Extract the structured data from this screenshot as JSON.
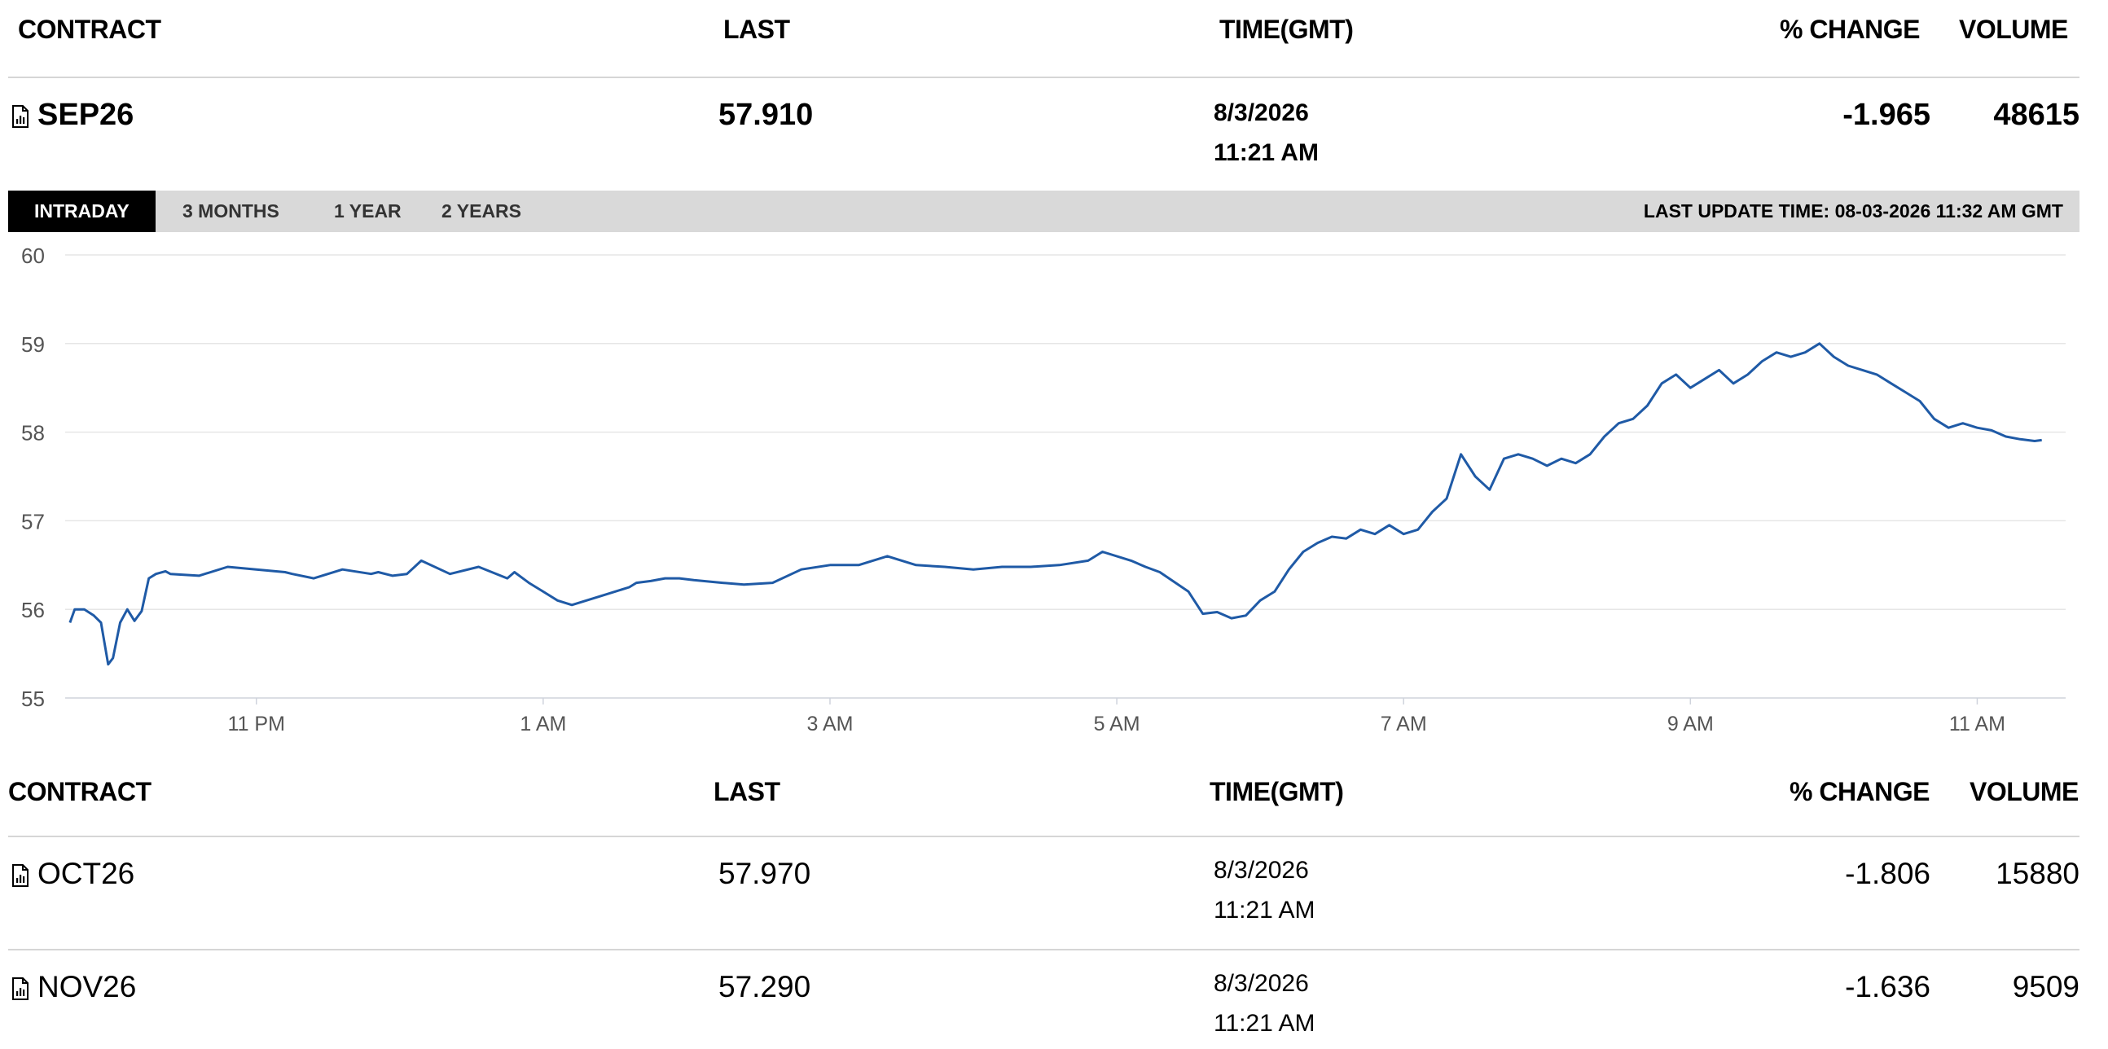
{
  "top_table": {
    "headers": {
      "contract": "CONTRACT",
      "last": "LAST",
      "time": "TIME(GMT)",
      "pct_change": "% CHANGE",
      "volume": "VOLUME"
    },
    "row": {
      "contract": "SEP26",
      "last": "57.910",
      "date": "8/3/2026",
      "time": "11:21 AM",
      "pct_change": "-1.965",
      "volume": "48615"
    }
  },
  "tabs": {
    "items": [
      "INTRADAY",
      "3 MONTHS",
      "1 YEAR",
      "2 YEARS"
    ],
    "active": "INTRADAY",
    "last_update": "LAST UPDATE TIME: 08-03-2026 11:32 AM GMT"
  },
  "chart_data": {
    "type": "line",
    "title": "",
    "xlabel": "",
    "ylabel": "",
    "ylim": [
      55,
      60
    ],
    "yticks": [
      "60",
      "59",
      "58",
      "57",
      "56",
      "55"
    ],
    "xticks": [
      "11 PM",
      "1 AM",
      "3 AM",
      "5 AM",
      "7 AM",
      "9 AM",
      "11 AM"
    ],
    "grid": true,
    "line_color": "#1f5aa6",
    "series": [
      {
        "name": "",
        "x": [
          "21:42",
          "21:44",
          "21:48",
          "21:52",
          "21:55",
          "21:58",
          "22:00",
          "22:03",
          "22:06",
          "22:09",
          "22:12",
          "22:15",
          "22:18",
          "22:22",
          "22:24",
          "22:36",
          "22:48",
          "23:00",
          "23:12",
          "23:15",
          "23:24",
          "23:36",
          "23:48",
          "23:51",
          "23:57",
          "00:03",
          "00:09",
          "00:21",
          "00:33",
          "00:45",
          "00:48",
          "00:54",
          "01:00",
          "01:06",
          "01:12",
          "01:24",
          "01:36",
          "01:39",
          "01:45",
          "01:51",
          "01:57",
          "02:03",
          "02:15",
          "02:24",
          "02:36",
          "02:48",
          "03:00",
          "03:12",
          "03:24",
          "03:36",
          "03:48",
          "04:00",
          "04:12",
          "04:24",
          "04:36",
          "04:48",
          "04:54",
          "05:06",
          "05:12",
          "05:18",
          "05:30",
          "05:36",
          "05:42",
          "05:48",
          "05:54",
          "06:00",
          "06:06",
          "06:12",
          "06:18",
          "06:24",
          "06:30",
          "06:36",
          "06:42",
          "06:48",
          "06:54",
          "07:00",
          "07:06",
          "07:12",
          "07:18",
          "07:24",
          "07:30",
          "07:36",
          "07:42",
          "07:48",
          "07:54",
          "08:00",
          "08:06",
          "08:12",
          "08:18",
          "08:24",
          "08:30",
          "08:36",
          "08:42",
          "08:48",
          "08:54",
          "09:00",
          "09:06",
          "09:12",
          "09:18",
          "09:24",
          "09:30",
          "09:36",
          "09:42",
          "09:48",
          "09:54",
          "10:00",
          "10:06",
          "10:12",
          "10:18",
          "10:24",
          "10:30",
          "10:36",
          "10:42",
          "10:48",
          "10:54",
          "11:00",
          "11:06",
          "11:12",
          "11:18",
          "11:24",
          "11:27"
        ],
        "values": [
          55.85,
          56.0,
          56.0,
          55.93,
          55.85,
          55.38,
          55.45,
          55.85,
          56.0,
          55.87,
          55.98,
          56.35,
          56.4,
          56.43,
          56.4,
          56.38,
          56.48,
          56.45,
          56.42,
          56.4,
          56.35,
          56.45,
          56.4,
          56.42,
          56.38,
          56.4,
          56.55,
          56.4,
          56.48,
          56.35,
          56.42,
          56.3,
          56.2,
          56.1,
          56.05,
          56.15,
          56.25,
          56.3,
          56.32,
          56.35,
          56.35,
          56.33,
          56.3,
          56.28,
          56.3,
          56.45,
          56.5,
          56.5,
          56.6,
          56.5,
          56.48,
          56.45,
          56.48,
          56.48,
          56.5,
          56.55,
          56.65,
          56.55,
          56.48,
          56.42,
          56.2,
          55.95,
          55.97,
          55.9,
          55.93,
          56.1,
          56.2,
          56.45,
          56.65,
          56.75,
          56.82,
          56.8,
          56.9,
          56.85,
          56.95,
          56.85,
          56.9,
          57.1,
          57.25,
          57.75,
          57.5,
          57.35,
          57.7,
          57.75,
          57.7,
          57.62,
          57.7,
          57.65,
          57.75,
          57.95,
          58.1,
          58.15,
          58.3,
          58.55,
          58.65,
          58.5,
          58.6,
          58.7,
          58.55,
          58.65,
          58.8,
          58.9,
          58.85,
          58.9,
          59.0,
          58.85,
          58.75,
          58.7,
          58.65,
          58.55,
          58.45,
          58.35,
          58.15,
          58.05,
          58.1,
          58.05,
          58.02,
          57.95,
          57.92,
          57.9,
          57.91
        ]
      }
    ]
  },
  "bottom_table": {
    "headers": {
      "contract": "CONTRACT",
      "last": "LAST",
      "time": "TIME(GMT)",
      "pct_change": "% CHANGE",
      "volume": "VOLUME"
    },
    "rows": [
      {
        "contract": "OCT26",
        "last": "57.970",
        "date": "8/3/2026",
        "time": "11:21 AM",
        "pct_change": "-1.806",
        "volume": "15880"
      },
      {
        "contract": "NOV26",
        "last": "57.290",
        "date": "8/3/2026",
        "time": "11:21 AM",
        "pct_change": "-1.636",
        "volume": "9509"
      }
    ]
  }
}
